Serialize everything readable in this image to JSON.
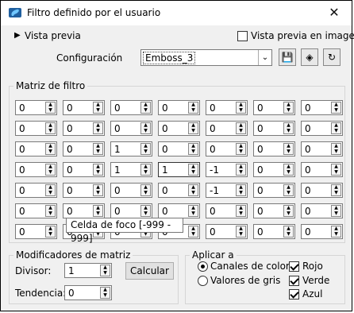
{
  "window": {
    "title": "Filtro definido por el usuario",
    "close_icon": "close-icon"
  },
  "preview": {
    "collapsed_label": "Vista previa",
    "in_image_label": "Vista previa en imagen",
    "in_image_checked": false
  },
  "config": {
    "label": "Configuración",
    "selected": "Emboss_3",
    "buttons": [
      "save-preset-icon",
      "preset-manager-icon",
      "reset-icon"
    ]
  },
  "matrix": {
    "title": "Matriz de filtro",
    "rows": [
      [
        "0",
        "0",
        "0",
        "0",
        "0",
        "0",
        "0"
      ],
      [
        "0",
        "0",
        "0",
        "0",
        "0",
        "0",
        "0"
      ],
      [
        "0",
        "0",
        "1",
        "0",
        "0",
        "0",
        "0"
      ],
      [
        "0",
        "0",
        "1",
        "1",
        "-1",
        "0",
        "0"
      ],
      [
        "0",
        "0",
        "0",
        "0",
        "-1",
        "0",
        "0"
      ],
      [
        "0",
        "0",
        "0",
        "0",
        "0",
        "0",
        "0"
      ],
      [
        "0",
        "0",
        "0",
        "0",
        "0",
        "0",
        "0"
      ]
    ],
    "tooltip": "Celda de foco [-999 - 999]"
  },
  "modifiers": {
    "title": "Modificadores de matriz",
    "divisor_label": "Divisor:",
    "divisor_value": "1",
    "bias_label": "Tendencia:",
    "bias_value": "0",
    "calculate_label": "Calcular"
  },
  "apply": {
    "title": "Aplicar a",
    "color_channels_label": "Canales de color",
    "grey_values_label": "Valores de gris",
    "color_channels_selected": true,
    "red_label": "Rojo",
    "green_label": "Verde",
    "blue_label": "Azul",
    "red_checked": true,
    "green_checked": true,
    "blue_checked": true
  }
}
